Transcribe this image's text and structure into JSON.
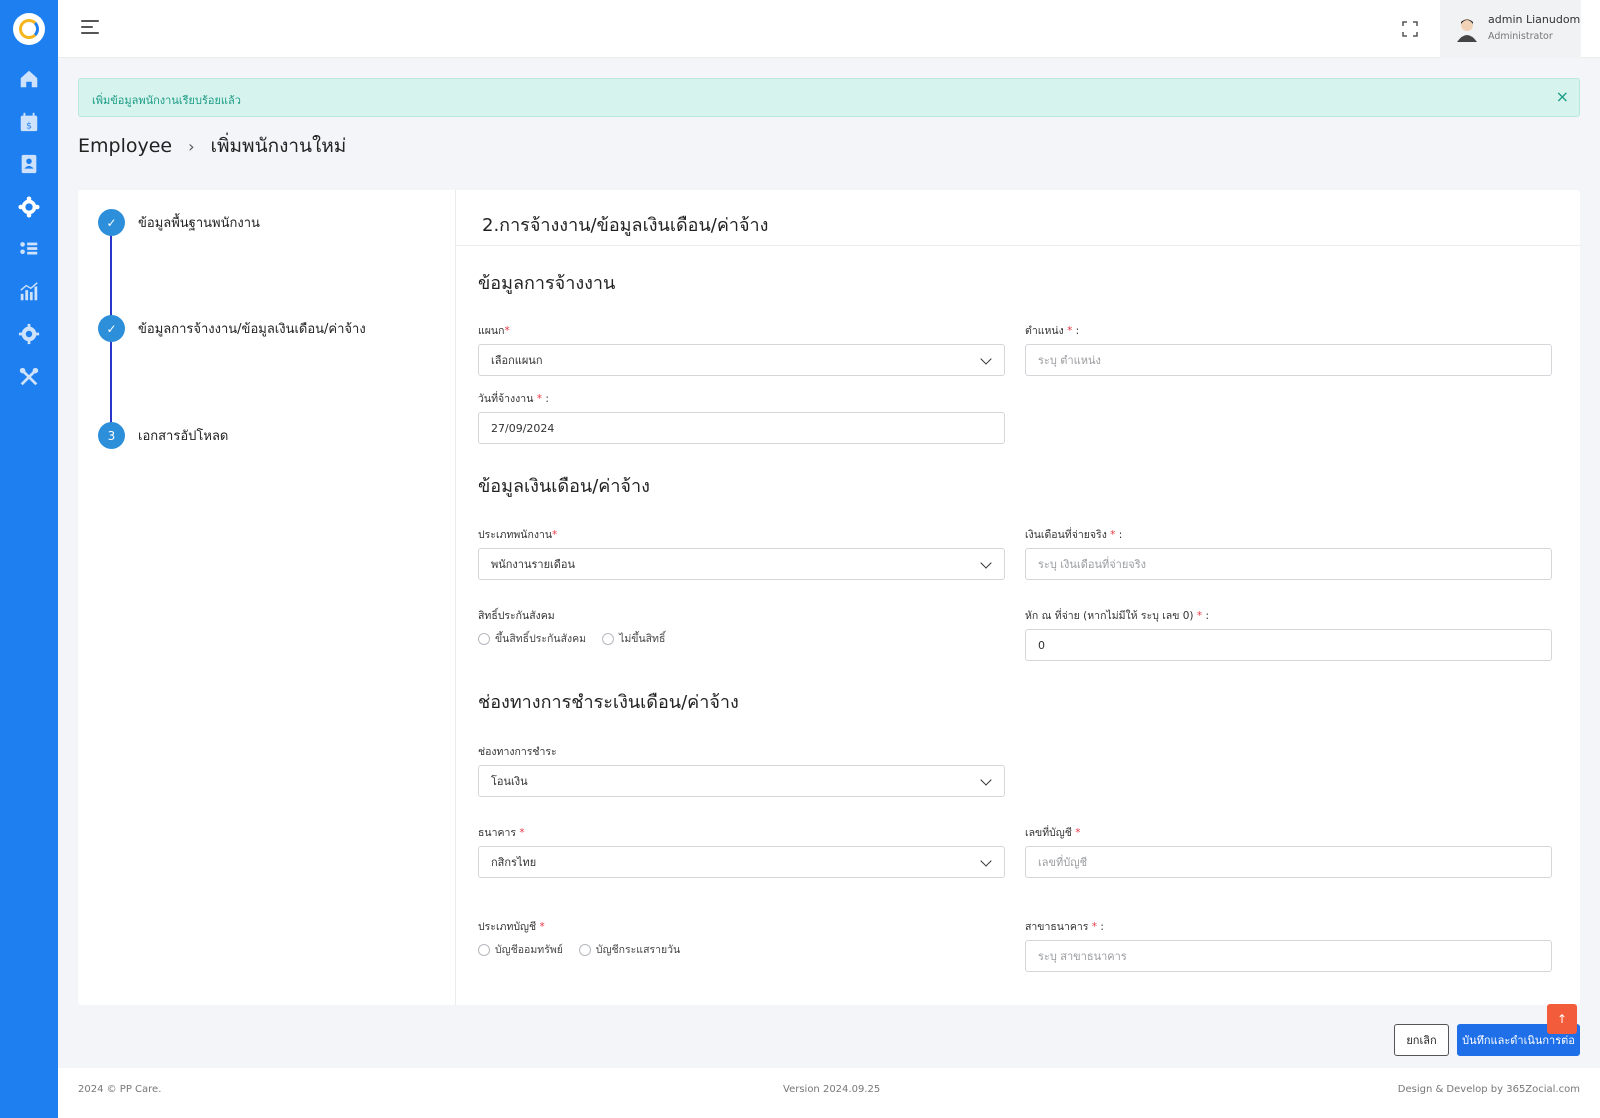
{
  "colors": {
    "sidebar": "#1e80f0",
    "primary": "#1e6fe8",
    "success_bg": "#d7f3ee",
    "success_text": "#1a9c84",
    "step": "#2d8fd9",
    "required": "#e63946",
    "scroll_top": "#f25c3b"
  },
  "sidebar": {
    "items": [
      {
        "icon": "home-icon"
      },
      {
        "icon": "calendar-money-icon"
      },
      {
        "icon": "contact-book-icon"
      },
      {
        "icon": "team-gear-icon"
      },
      {
        "icon": "list-people-icon"
      },
      {
        "icon": "bar-chart-icon"
      },
      {
        "icon": "gear-icon"
      },
      {
        "icon": "tools-icon"
      }
    ]
  },
  "header": {
    "user_name": "admin Lianudom",
    "user_role": "Administrator"
  },
  "alert": {
    "message": "เพิ่มข้อมูลพนักงานเรียบร้อยแล้ว",
    "close": "×"
  },
  "breadcrumb": {
    "parent": "Employee",
    "separator": "›",
    "current": "เพิ่มพนักงานใหม่"
  },
  "steps": [
    {
      "label": "ข้อมูลพื้นฐานพนักงาน",
      "marker": "✓"
    },
    {
      "label": "ข้อมูลการจ้างงาน/ข้อมูลเงินเดือน/ค่าจ้าง",
      "marker": "✓"
    },
    {
      "label": "เอกสารอัปโหลด",
      "marker": "3"
    }
  ],
  "form": {
    "title": "2.การจ้างงาน/ข้อมูลเงินเดือน/ค่าจ้าง",
    "employment": {
      "section_title": "ข้อมูลการจ้างงาน",
      "department_label": "แผนก",
      "department_value": "เลือกแผนก",
      "position_label": "ตำแหน่ง",
      "position_placeholder": "ระบุ ตำแหน่ง",
      "hire_date_label": "วันที่จ้างงาน",
      "hire_date_value": "27/09/2024"
    },
    "salary": {
      "section_title": "ข้อมูลเงินเดือน/ค่าจ้าง",
      "employee_type_label": "ประเภทพนักงาน",
      "employee_type_value": "พนักงานรายเดือน",
      "actual_salary_label": "เงินเดือนที่จ่ายจริง",
      "actual_salary_placeholder": "ระบุ เงินเดือนที่จ่ายจริง",
      "social_security_label": "สิทธิ์ประกันสังคม",
      "social_security_options": [
        "ขึ้นสิทธิ์ประกันสังคม",
        "ไม่ขึ้นสิทธิ์"
      ],
      "withholding_label": "หัก ณ ที่จ่าย (หากไม่มีให้ ระบุ เลข 0)",
      "withholding_value": "0"
    },
    "payment": {
      "section_title": "ช่องทางการชำระเงินเดือน/ค่าจ้าง",
      "channel_label": "ช่องทางการชำระ",
      "channel_value": "โอนเงิน",
      "bank_label": "ธนาคาร",
      "bank_value": "กสิกรไทย",
      "account_number_label": "เลขที่บัญชี",
      "account_number_placeholder": "เลขที่บัญชี",
      "account_type_label": "ประเภทบัญชี",
      "account_type_options": [
        "บัญชีออมทรัพย์",
        "บัญชีกระแสรายวัน"
      ],
      "branch_label": "สาขาธนาคาร",
      "branch_placeholder": "ระบุ สาขาธนาคาร"
    },
    "required_mark": "*",
    "colon": ":"
  },
  "actions": {
    "cancel": "ยกเลิก",
    "save": "บันทึกและดำเนินการต่อ",
    "scroll_top": "↑"
  },
  "footer": {
    "copyright": "2024 © PP Care.",
    "version": "Version 2024.09.25",
    "credit": "Design & Develop by 365Zocial.com"
  }
}
